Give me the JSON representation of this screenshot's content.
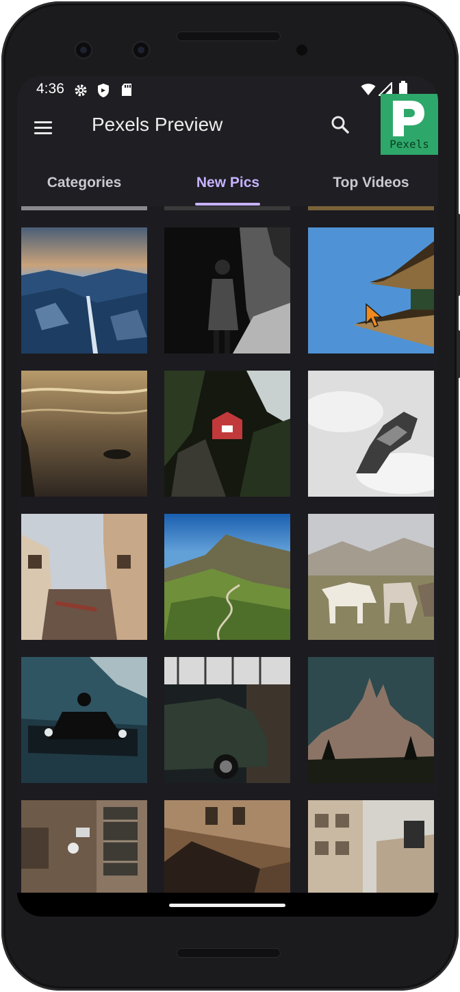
{
  "status_bar": {
    "time": "4:36"
  },
  "app_bar": {
    "title": "Pexels Preview",
    "logo_text": "Pexels",
    "logo_color": "#2ea86a"
  },
  "tabs": [
    {
      "label": "Categories",
      "active": false
    },
    {
      "label": "New Pics",
      "active": true
    },
    {
      "label": "Top Videos",
      "active": false
    }
  ],
  "accent_color": "#c7b3ff",
  "photos": [
    "snowy-mountain-valley-dusk",
    "person-in-coat-black-and-white",
    "pagoda-roof-blue-sky",
    "sunset-beach-waves",
    "red-birdhouse-in-tree",
    "rock-in-clouds",
    "old-town-street",
    "green-mountain-road",
    "white-horses-pasture",
    "person-on-car-dark",
    "car-under-window",
    "gothic-cathedral-dusk",
    "old-stone-building",
    "brick-building-corner",
    "city-street-buildings"
  ]
}
